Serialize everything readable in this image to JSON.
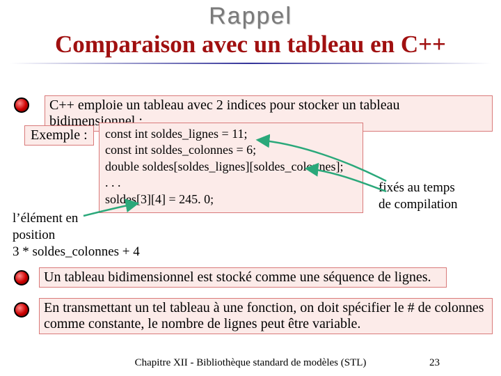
{
  "header": {
    "rappel": "Rappel",
    "title": "Comparaison avec un tableau en C++"
  },
  "bullets": [
    "C++ emploie un tableau avec 2 indices pour stocker un tableau bidimensionnel :",
    "Un tableau bidimensionnel est stocké comme une séquence de lignes.",
    "En transmettant un tel tableau à une fonction, on doit spécifier le # de colonnes comme constante, le nombre de lignes peut être variable."
  ],
  "example": {
    "label": "Exemple :",
    "code_lines": [
      "const int soldes_lignes = 11;",
      "const int soldes_colonnes = 6;",
      "double soldes[soldes_lignes][soldes_colonnes];",
      ". . .",
      "soldes[3][4] = 245. 0;"
    ]
  },
  "annotations": {
    "right": "fixés au temps\nde compilation",
    "bottom": "l’élément en\nposition\n3 * soldes_colonnes + 4"
  },
  "footer": {
    "chapter": "Chapitre XII - Bibliothèque standard de modèles (STL)",
    "page": "23"
  }
}
